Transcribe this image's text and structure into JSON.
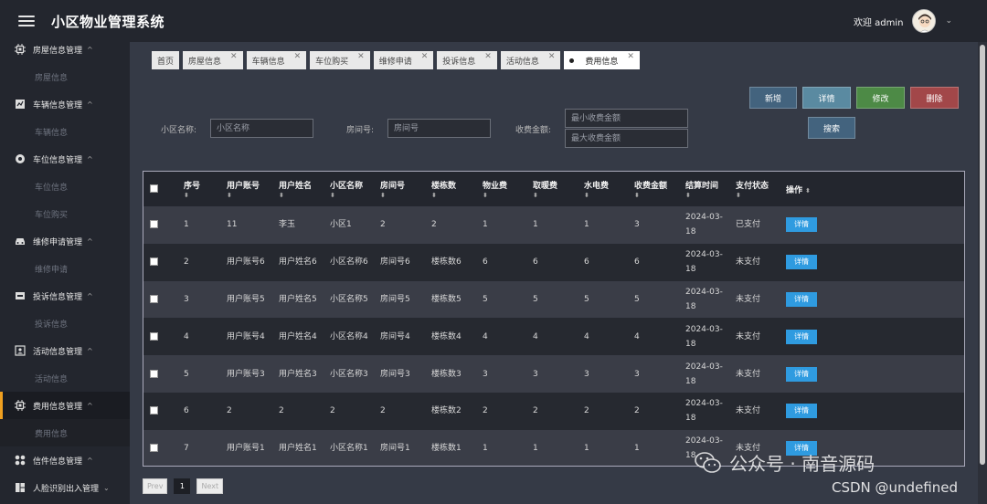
{
  "app": {
    "title": "小区物业管理系统"
  },
  "header": {
    "welcome": "欢迎 admin"
  },
  "sidebar": {
    "groups": [
      {
        "label": "房屋信息管理",
        "icon": "chip-icon",
        "subs": [
          "房屋信息"
        ]
      },
      {
        "label": "车辆信息管理",
        "icon": "chart-icon",
        "subs": [
          "车辆信息"
        ]
      },
      {
        "label": "车位信息管理",
        "icon": "record-icon",
        "subs": [
          "车位信息",
          "车位购买"
        ]
      },
      {
        "label": "维修申请管理",
        "icon": "car-icon",
        "subs": [
          "维修申请"
        ]
      },
      {
        "label": "投诉信息管理",
        "icon": "inbox-icon",
        "subs": [
          "投诉信息"
        ]
      },
      {
        "label": "活动信息管理",
        "icon": "id-card-icon",
        "subs": [
          "活动信息"
        ]
      },
      {
        "label": "费用信息管理",
        "icon": "chip-icon",
        "subs": [
          "费用信息"
        ],
        "active": true
      },
      {
        "label": "信件信息管理",
        "icon": "grid-icon",
        "subs": []
      },
      {
        "label": "人脸识别出入管理",
        "icon": "dashboard-icon",
        "subs": []
      }
    ]
  },
  "tabs": [
    "首页",
    "房屋信息",
    "车辆信息",
    "车位购买",
    "维修申请",
    "投诉信息",
    "活动信息",
    "费用信息"
  ],
  "active_tab": "费用信息",
  "actions": {
    "add": "新增",
    "detail": "详情",
    "edit": "修改",
    "delete": "删除",
    "search": "搜索"
  },
  "search": {
    "community_label": "小区名称:",
    "community_placeholder": "小区名称",
    "room_label": "房间号:",
    "room_placeholder": "房间号",
    "amount_label": "收费金额:",
    "amount_min_placeholder": "最小收费金额",
    "amount_max_placeholder": "最大收费金额"
  },
  "table": {
    "columns": [
      "序号",
      "用户账号",
      "用户姓名",
      "小区名称",
      "房间号",
      "楼栋数",
      "物业费",
      "取暖费",
      "水电费",
      "收费金额",
      "结算时间",
      "支付状态",
      "操作"
    ],
    "row_button": "详情",
    "rows": [
      [
        "1",
        "11",
        "李玉",
        "小区1",
        "2",
        "2",
        "1",
        "1",
        "1",
        "3",
        "2024-03-18",
        "已支付"
      ],
      [
        "2",
        "用户账号6",
        "用户姓名6",
        "小区名称6",
        "房间号6",
        "楼栋数6",
        "6",
        "6",
        "6",
        "6",
        "2024-03-18",
        "未支付"
      ],
      [
        "3",
        "用户账号5",
        "用户姓名5",
        "小区名称5",
        "房间号5",
        "楼栋数5",
        "5",
        "5",
        "5",
        "5",
        "2024-03-18",
        "未支付"
      ],
      [
        "4",
        "用户账号4",
        "用户姓名4",
        "小区名称4",
        "房间号4",
        "楼栋数4",
        "4",
        "4",
        "4",
        "4",
        "2024-03-18",
        "未支付"
      ],
      [
        "5",
        "用户账号3",
        "用户姓名3",
        "小区名称3",
        "房间号3",
        "楼栋数3",
        "3",
        "3",
        "3",
        "3",
        "2024-03-18",
        "未支付"
      ],
      [
        "6",
        "2",
        "2",
        "2",
        "2",
        "楼栋数2",
        "2",
        "2",
        "2",
        "2",
        "2024-03-18",
        "未支付"
      ],
      [
        "7",
        "用户账号1",
        "用户姓名1",
        "小区名称1",
        "房间号1",
        "楼栋数1",
        "1",
        "1",
        "1",
        "1",
        "2024-03-18",
        "未支付"
      ]
    ]
  },
  "pagination": {
    "prev": "Prev",
    "current": "1",
    "next": "Next"
  },
  "watermark": {
    "line1": "公众号 · 南音源码",
    "line2": "CSDN @undefined"
  }
}
